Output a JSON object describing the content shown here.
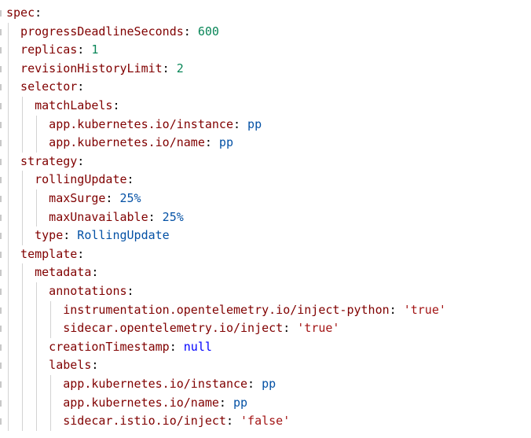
{
  "editor": {
    "language": "yaml",
    "lines": [
      {
        "indent": 0,
        "key": "spec",
        "sep": ":",
        "value": "",
        "value_type": "none"
      },
      {
        "indent": 1,
        "key": "progressDeadlineSeconds",
        "sep": ": ",
        "value": "600",
        "value_type": "number"
      },
      {
        "indent": 1,
        "key": "replicas",
        "sep": ": ",
        "value": "1",
        "value_type": "number"
      },
      {
        "indent": 1,
        "key": "revisionHistoryLimit",
        "sep": ": ",
        "value": "2",
        "value_type": "number"
      },
      {
        "indent": 1,
        "key": "selector",
        "sep": ":",
        "value": "",
        "value_type": "none"
      },
      {
        "indent": 2,
        "key": "matchLabels",
        "sep": ":",
        "value": "",
        "value_type": "none"
      },
      {
        "indent": 3,
        "key": "app.kubernetes.io/instance",
        "sep": ": ",
        "value": "pp",
        "value_type": "plain"
      },
      {
        "indent": 3,
        "key": "app.kubernetes.io/name",
        "sep": ": ",
        "value": "pp",
        "value_type": "plain"
      },
      {
        "indent": 1,
        "key": "strategy",
        "sep": ":",
        "value": "",
        "value_type": "none"
      },
      {
        "indent": 2,
        "key": "rollingUpdate",
        "sep": ":",
        "value": "",
        "value_type": "none"
      },
      {
        "indent": 3,
        "key": "maxSurge",
        "sep": ": ",
        "value": "25%",
        "value_type": "plain"
      },
      {
        "indent": 3,
        "key": "maxUnavailable",
        "sep": ": ",
        "value": "25%",
        "value_type": "plain"
      },
      {
        "indent": 2,
        "key": "type",
        "sep": ": ",
        "value": "RollingUpdate",
        "value_type": "plain"
      },
      {
        "indent": 1,
        "key": "template",
        "sep": ":",
        "value": "",
        "value_type": "none"
      },
      {
        "indent": 2,
        "key": "metadata",
        "sep": ":",
        "value": "",
        "value_type": "none"
      },
      {
        "indent": 3,
        "key": "annotations",
        "sep": ":",
        "value": "",
        "value_type": "none"
      },
      {
        "indent": 4,
        "key": "instrumentation.opentelemetry.io/inject-python",
        "sep": ": ",
        "value": "'true'",
        "value_type": "string"
      },
      {
        "indent": 4,
        "key": "sidecar.opentelemetry.io/inject",
        "sep": ": ",
        "value": "'true'",
        "value_type": "string"
      },
      {
        "indent": 3,
        "key": "creationTimestamp",
        "sep": ": ",
        "value": "null",
        "value_type": "keyword"
      },
      {
        "indent": 3,
        "key": "labels",
        "sep": ":",
        "value": "",
        "value_type": "none"
      },
      {
        "indent": 4,
        "key": "app.kubernetes.io/instance",
        "sep": ": ",
        "value": "pp",
        "value_type": "plain"
      },
      {
        "indent": 4,
        "key": "app.kubernetes.io/name",
        "sep": ": ",
        "value": "pp",
        "value_type": "plain"
      },
      {
        "indent": 4,
        "key": "sidecar.istio.io/inject",
        "sep": ": ",
        "value": "'false'",
        "value_type": "string"
      }
    ]
  },
  "colors": {
    "key": "#800000",
    "number": "#098658",
    "string": "#a31515",
    "plain": "#0451a5",
    "keyword": "#0000ff",
    "indent_guide": "#d3d3d3",
    "background": "#ffffff"
  }
}
